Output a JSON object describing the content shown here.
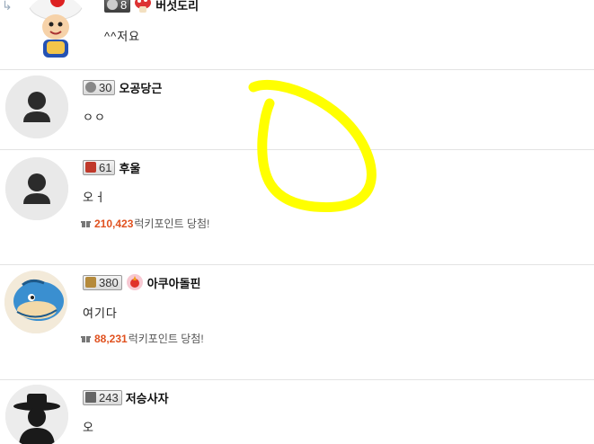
{
  "comments": [
    {
      "nickname": "버섯도리",
      "level": "8",
      "text": "^^저요",
      "avatar": "toad-avatar"
    },
    {
      "nickname": "오공당근",
      "level": "30",
      "text": "ㅇㅇ",
      "avatar": "default-avatar"
    },
    {
      "nickname": "후울",
      "level": "61",
      "text": "오ㅓ",
      "avatar": "default-avatar",
      "reward_points": "210,423",
      "reward_label": "럭키포인트 당첨!"
    },
    {
      "nickname": "아쿠아돌핀",
      "level": "380",
      "text": "여기다",
      "avatar": "dolphin-avatar",
      "reward_points": "88,231",
      "reward_label": "럭키포인트 당첨!"
    },
    {
      "nickname": "저승사자",
      "level": "243",
      "text": "오",
      "avatar": "reaper-avatar"
    }
  ],
  "reply_arrow": "↳",
  "annotation_color": "#ffff00",
  "colors": {
    "points": "#e0511f",
    "divider": "#e3e3e3"
  }
}
